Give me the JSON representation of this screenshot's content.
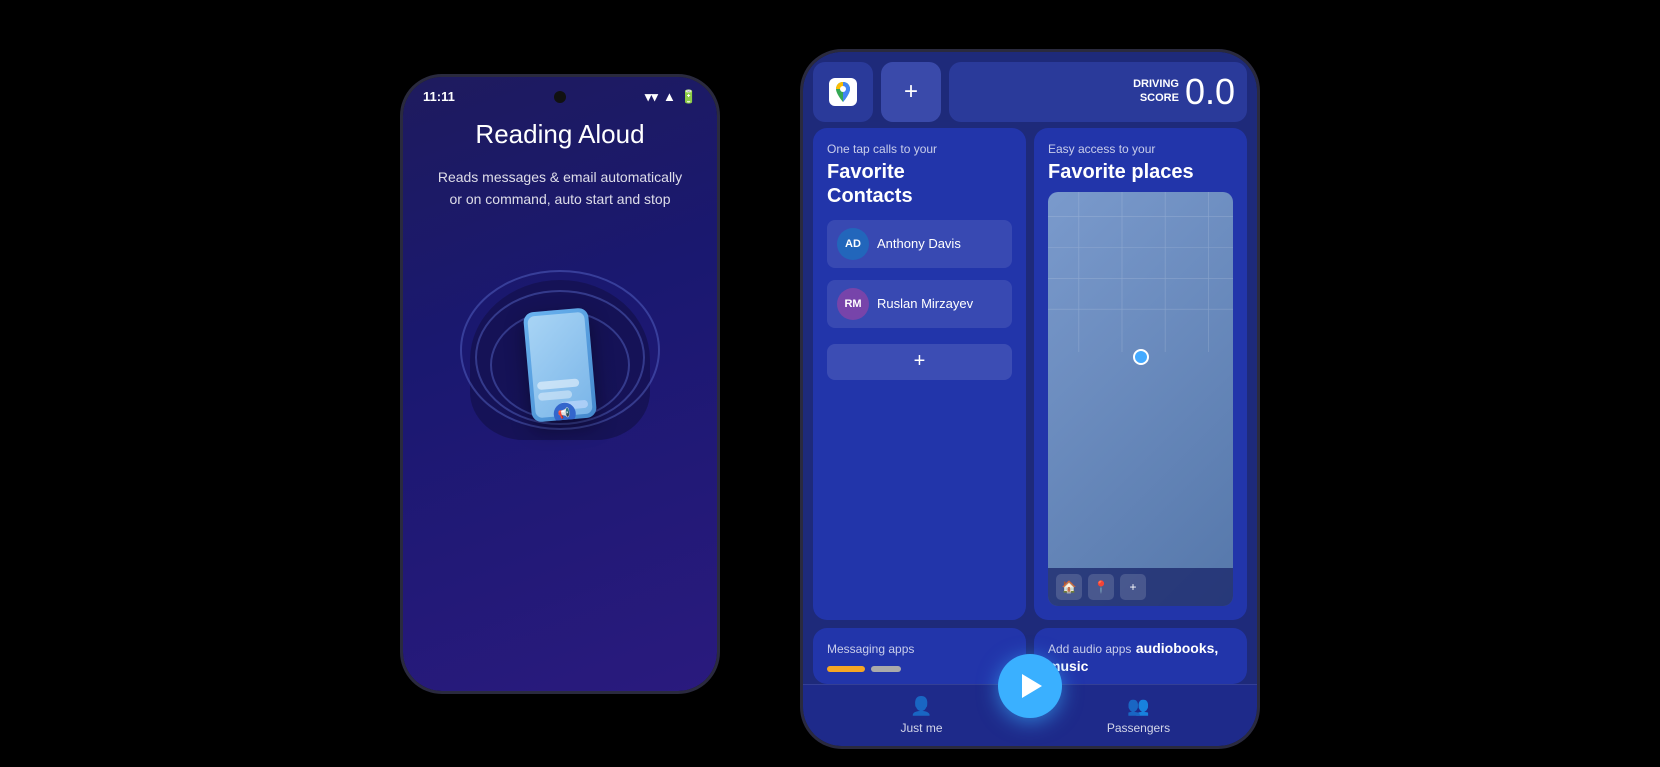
{
  "left_phone": {
    "status_bar": {
      "time": "11:11"
    },
    "title": "Reading Aloud",
    "description": "Reads messages & email automatically\nor on command, auto start and stop"
  },
  "right_phone": {
    "top_bar": {
      "plus_label": "+",
      "driving_score_label": "DRIVING\nSCORE",
      "driving_score_value": "0.0"
    },
    "contacts_card": {
      "subtitle": "One tap calls to your",
      "title_line1": "Favorite",
      "title_line2": "Contacts",
      "contacts": [
        {
          "initials": "AD",
          "name": "Anthony Davis"
        },
        {
          "initials": "RM",
          "name": "Ruslan Mirzayev"
        }
      ],
      "add_label": "+"
    },
    "places_card": {
      "subtitle": "Easy access to your",
      "title": "Favorite places"
    },
    "messaging_card": {
      "title": "Messaging apps"
    },
    "audio_card": {
      "title": "Add audio apps",
      "subtitle": "audiobooks, music"
    },
    "bottom_nav": {
      "just_me": "Just me",
      "passengers": "Passengers"
    }
  }
}
